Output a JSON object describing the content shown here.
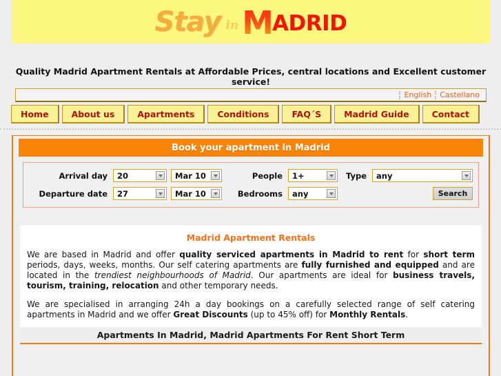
{
  "banner": {
    "logo_stay": "Stay",
    "logo_in": "in",
    "logo_m": "M",
    "logo_adrid": "ADRID",
    "bg_color": "#fcf87f",
    "stay_color": "#f2ad3a",
    "madrid_color": "#f41405"
  },
  "tagline": "Quality Madrid Apartment Rentals at Affordable Prices, central locations and Excellent customer service!",
  "language_bar": {
    "english": "English",
    "castellano": "Castellano",
    "link_color": "#e8621e"
  },
  "nav": {
    "items": [
      {
        "label": "Home"
      },
      {
        "label": "About us"
      },
      {
        "label": "Apartments"
      },
      {
        "label": "Conditions"
      },
      {
        "label": "FAQ´S"
      },
      {
        "label": "Madrid Guide"
      },
      {
        "label": "Contact"
      }
    ],
    "bg_color": "#fbf196",
    "text_color": "#b01305"
  },
  "booking": {
    "title": "Book your apartment in Madrid",
    "title_bg": "#f98407",
    "arrival_label": "Arrival day",
    "arrival_day": "20",
    "arrival_month": "Mar 10",
    "departure_label": "Departure date",
    "departure_day": "27",
    "departure_month": "Mar 10",
    "people_label": "People",
    "people_value": "1+",
    "bedrooms_label": "Bedrooms",
    "bedrooms_value": "any",
    "type_label": "Type",
    "type_value": "any",
    "search_label": "Search"
  },
  "article": {
    "title": "Madrid Apartment Rentals",
    "p1": {
      "t1": "We are based in Madrid and offer ",
      "b1": "quality serviced apartments in Madrid to rent",
      "t2": " for ",
      "b2": "short term",
      "t3": " periods, days, weeks, months. Our self catering apartments are ",
      "b3": "fully furnished and equipped",
      "t4": " and are located in the ",
      "i1": "trendiest neighbourhoods of Madrid",
      "t5": ". Our apartments are ideal for ",
      "b4": "business travels, tourism, training, relocation",
      "t6": " and other temporary needs."
    },
    "p2": {
      "t1": "We are specialised in arranging 24h a day bookings on a carefully selected range of self catering apartments in Madrid and we offer ",
      "b1": "Great Discounts",
      "t2": " (up to 45% off) for ",
      "b2": "Monthly Rentals",
      "t3": "."
    }
  },
  "subheading": "Apartments In Madrid, Madrid Apartments For Rent Short Term"
}
